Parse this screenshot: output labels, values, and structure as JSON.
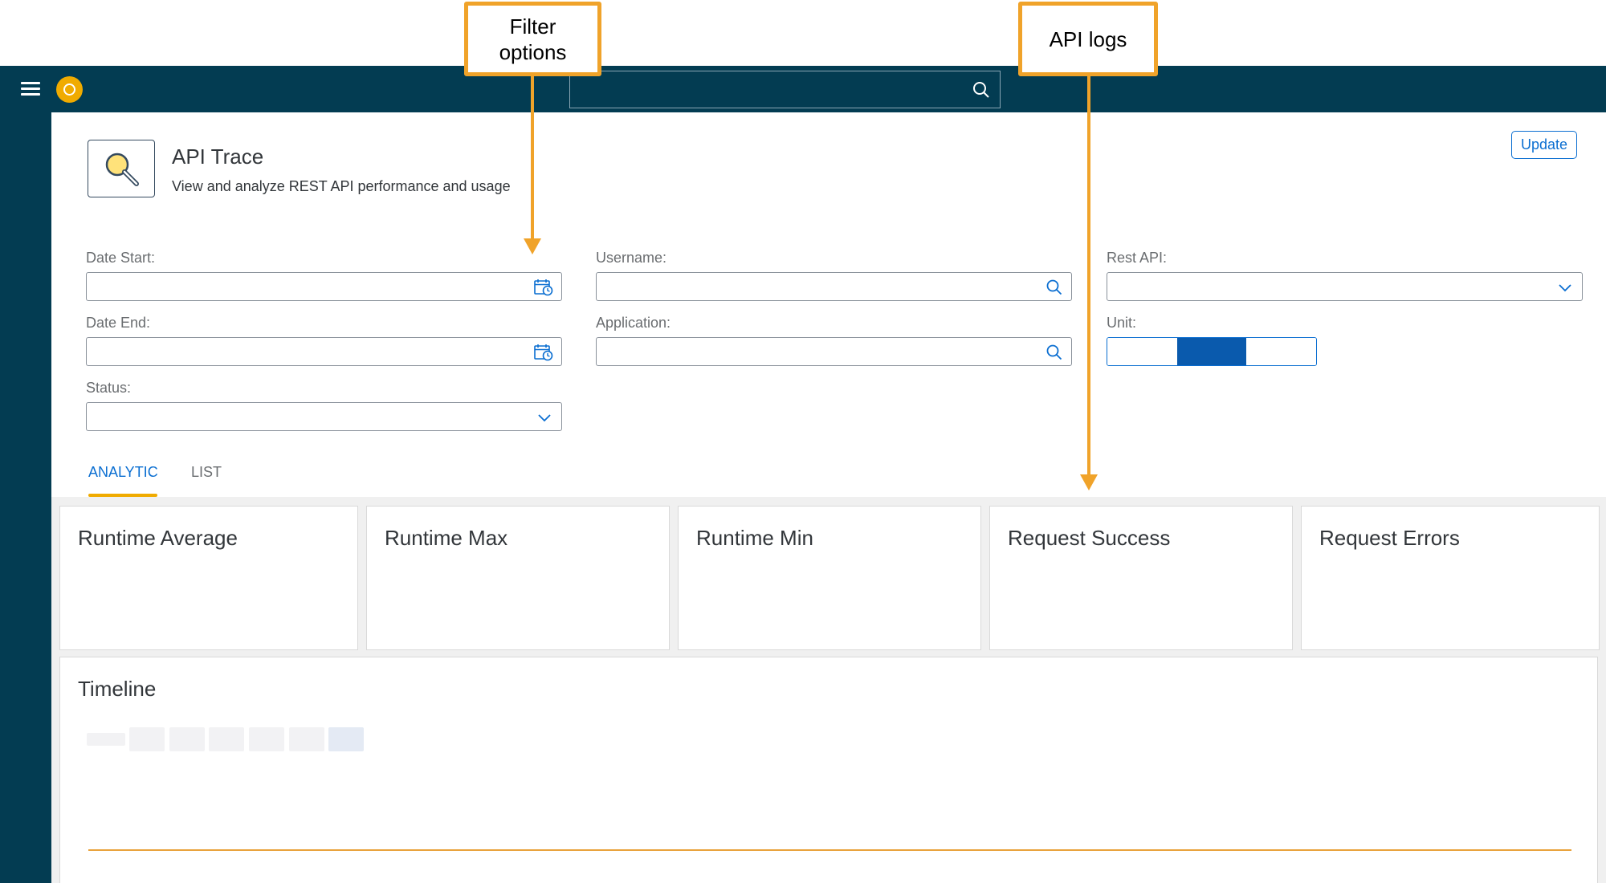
{
  "shell": {
    "search_placeholder": ""
  },
  "app": {
    "title": "API Trace",
    "subtitle": "View and analyze REST API performance and usage",
    "update_label": "Update"
  },
  "filters": {
    "date_start": {
      "label": "Date Start:",
      "value": ""
    },
    "date_end": {
      "label": "Date End:",
      "value": ""
    },
    "status": {
      "label": "Status:",
      "value": ""
    },
    "username": {
      "label": "Username:",
      "value": ""
    },
    "application": {
      "label": "Application:",
      "value": ""
    },
    "rest_api": {
      "label": "Rest API:",
      "value": ""
    },
    "unit": {
      "label": "Unit:",
      "selected_index": 1
    }
  },
  "tabs": [
    {
      "label": "ANALYTIC",
      "active": true
    },
    {
      "label": "LIST",
      "active": false
    }
  ],
  "tiles": [
    {
      "title": "Runtime Average"
    },
    {
      "title": "Runtime Max"
    },
    {
      "title": "Runtime Min"
    },
    {
      "title": "Request Success"
    },
    {
      "title": "Request Errors"
    }
  ],
  "timeline": {
    "title": "Timeline"
  },
  "callouts": {
    "filter": "Filter\noptions",
    "api_logs": "API logs"
  },
  "colors": {
    "shell": "#033c52",
    "accent": "#0a6ed1",
    "highlight": "#f0a32a",
    "logo": "#f0ab00"
  }
}
